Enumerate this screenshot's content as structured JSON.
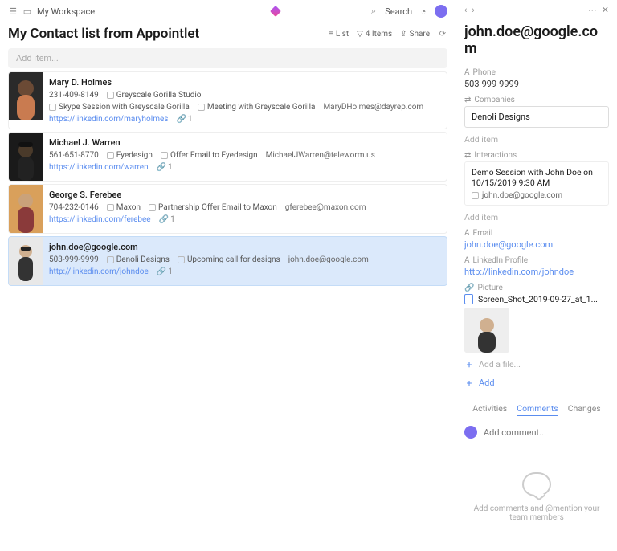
{
  "topbar": {
    "workspace": "My Workspace",
    "search": "Search"
  },
  "page": {
    "title": "My Contact list from Appointlet",
    "list_label": "List",
    "items_label": "4 Items",
    "share_label": "Share",
    "add_item_placeholder": "Add item..."
  },
  "contacts": [
    {
      "name": "Mary D. Holmes",
      "phone": "231-409-8149",
      "company": "Greyscale Gorilla Studio",
      "meetings": [
        "Skype Session with Greyscale Gorilla",
        "Meeting with Greyscale Gorilla"
      ],
      "email": "MaryDHolmes@dayrep.com",
      "linkedin": "https://linkedin.com/maryholmes",
      "badge": "1"
    },
    {
      "name": "Michael J. Warren",
      "phone": "561-651-8770",
      "company": "Eyedesign",
      "meetings": [
        "Offer Email to Eyedesign"
      ],
      "email": "MichaelJWarren@teleworm.us",
      "linkedin": "https://linkedin.com/warren",
      "badge": "1"
    },
    {
      "name": "George S. Ferebee",
      "phone": "704-232-0146",
      "company": "Maxon",
      "meetings": [
        "Partnership Offer Email to Maxon"
      ],
      "email": "gferebee@maxon.com",
      "linkedin": "https://linkedin.com/ferebee",
      "badge": "1"
    },
    {
      "name": "john.doe@google.com",
      "phone": "503-999-9999",
      "company": "Denoli Designs",
      "meetings": [
        "Upcoming call for designs"
      ],
      "email": "john.doe@google.com",
      "linkedin": "http://linkedin.com/johndoe",
      "badge": "1"
    }
  ],
  "detail": {
    "title": "john.doe@google.com",
    "phone_label": "Phone",
    "phone": "503-999-9999",
    "companies_label": "Companies",
    "company": "Denoli Designs",
    "add_item": "Add item",
    "interactions_label": "Interactions",
    "interaction_title": "Demo Session with John Doe on 10/15/2019 9:30 AM",
    "interaction_sub": "john.doe@google.com",
    "email_label": "Email",
    "email": "john.doe@google.com",
    "linkedin_label": "LinkedIn Profile",
    "linkedin": "http://linkedin.com/johndoe",
    "picture_label": "Picture",
    "picture_file": "Screen_Shot_2019-09-27_at_1...",
    "add_file": "Add a file...",
    "add": "Add",
    "tabs": {
      "activities": "Activities",
      "comments": "Comments",
      "changes": "Changes"
    },
    "comment_placeholder": "Add comment...",
    "empty": "Add comments and @mention your team members"
  }
}
